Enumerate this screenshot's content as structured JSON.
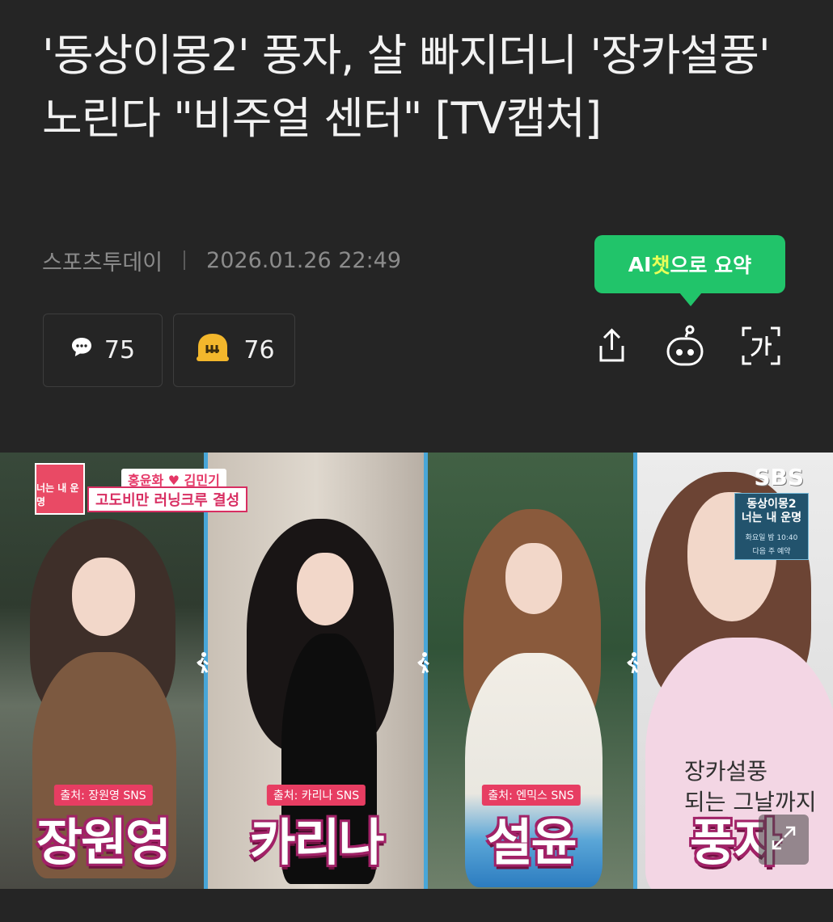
{
  "article": {
    "headline": "'동상이몽2' 풍자, 살 빠지더니 '장카설풍' 노린다 \"비주얼 센터\" [TV캡처]",
    "source": "스포츠투데이",
    "datetime": "2026.01.26 22:49"
  },
  "ai_summary": {
    "prefix": "AI",
    "highlight": "챗",
    "suffix": "으로 요약"
  },
  "counts": {
    "comments": "75",
    "reactions": "76"
  },
  "image": {
    "show_badge": "너는 내 운명",
    "caption_names": "홍윤화 ♥ 김민기",
    "caption_main": "고도비만 러닝크루 결성",
    "broadcaster": "SBS",
    "program": {
      "line1": "동상이몽2",
      "line2": "너는 내 운명",
      "line3": "화요일 밤 10:40",
      "line4": "다음 주 예약"
    },
    "panels": [
      {
        "name": "장원영",
        "source": "출처: 장원영 SNS"
      },
      {
        "name": "카리나",
        "source": "출처: 카리나 SNS"
      },
      {
        "name": "설윤",
        "source": "출처: 엔믹스 SNS"
      },
      {
        "name": "풍자",
        "source": ""
      }
    ],
    "hoodie_text": "장카설풍\n되는 그날까지"
  },
  "colors": {
    "background": "#252525",
    "accent_green": "#21c46a",
    "reaction_icon": "#f3b72c",
    "divider": "#48a6d8"
  }
}
